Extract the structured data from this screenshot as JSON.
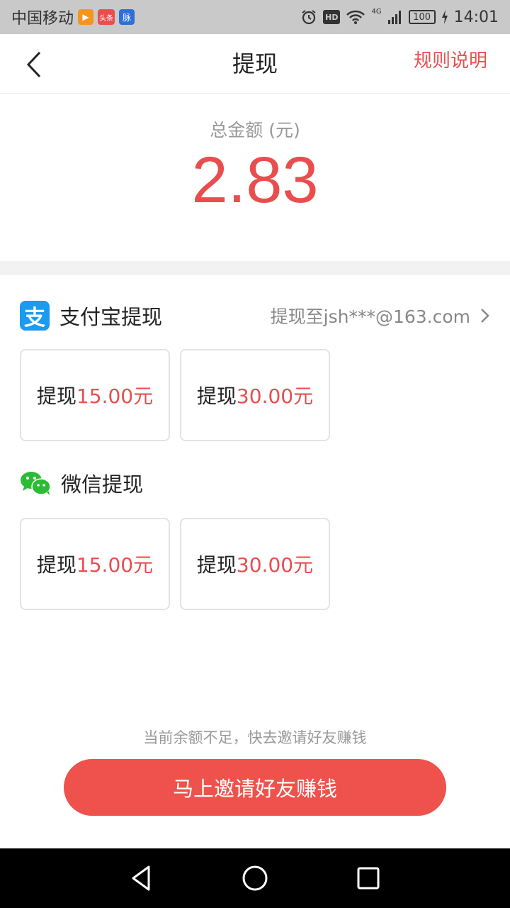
{
  "status_bar": {
    "carrier": "中国移动",
    "app_icons": [
      {
        "name": "video-app-icon",
        "color": "#f7941d",
        "glyph": "▶"
      },
      {
        "name": "toutiao-app-icon",
        "color": "#e94e4e",
        "glyph": "头条"
      },
      {
        "name": "maimai-app-icon",
        "color": "#2f6fd6",
        "glyph": "脉"
      }
    ],
    "hd_badge": "HD",
    "network": "4G",
    "battery": "100",
    "time": "14:01"
  },
  "header": {
    "title": "提现",
    "rules_label": "规则说明"
  },
  "balance": {
    "label": "总金额 (元)",
    "value": "2.83"
  },
  "alipay": {
    "title": "支付宝提现",
    "account": "提现至jsh***@163.com",
    "options": [
      {
        "prefix": "提现",
        "amount": "15.00元"
      },
      {
        "prefix": "提现",
        "amount": "30.00元"
      }
    ]
  },
  "wechat": {
    "title": "微信提现",
    "options": [
      {
        "prefix": "提现",
        "amount": "15.00元"
      },
      {
        "prefix": "提现",
        "amount": "30.00元"
      }
    ]
  },
  "footer": {
    "hint": "当前余额不足，快去邀请好友赚钱",
    "invite_label": "马上邀请好友赚钱"
  },
  "colors": {
    "accent": "#e94e4e",
    "alipay_blue": "#1a9bf0",
    "wechat_green": "#2dbb35"
  }
}
